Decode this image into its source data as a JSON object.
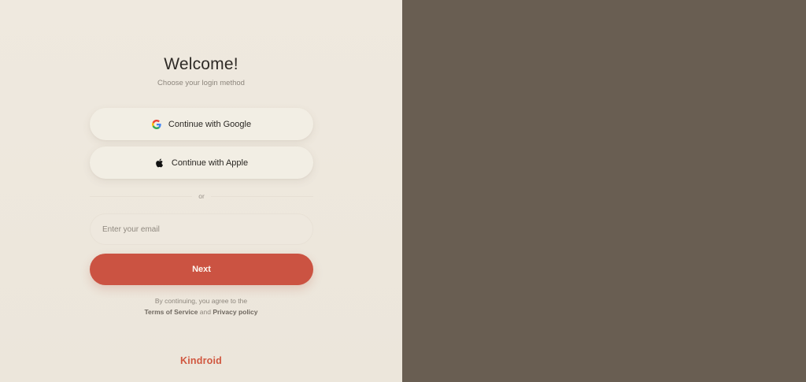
{
  "header": {
    "title": "Welcome!",
    "subtitle": "Choose your login method"
  },
  "auth": {
    "google_label": "Continue with Google",
    "apple_label": "Continue with Apple",
    "divider_label": "or",
    "email_placeholder": "Enter your email",
    "email_value": "",
    "next_label": "Next"
  },
  "legal": {
    "prefix": "By continuing, you agree to the",
    "terms_label": "Terms of Service",
    "and_label": "and",
    "privacy_label": "Privacy policy"
  },
  "brand": {
    "name": "Kindroid"
  },
  "icons": {
    "google": "google-logo-icon",
    "apple": "apple-logo-icon"
  },
  "colors": {
    "accent": "#cb5342",
    "left_background": "#ece6dc",
    "right_background": "#695e52",
    "brand": "#d0573f"
  }
}
